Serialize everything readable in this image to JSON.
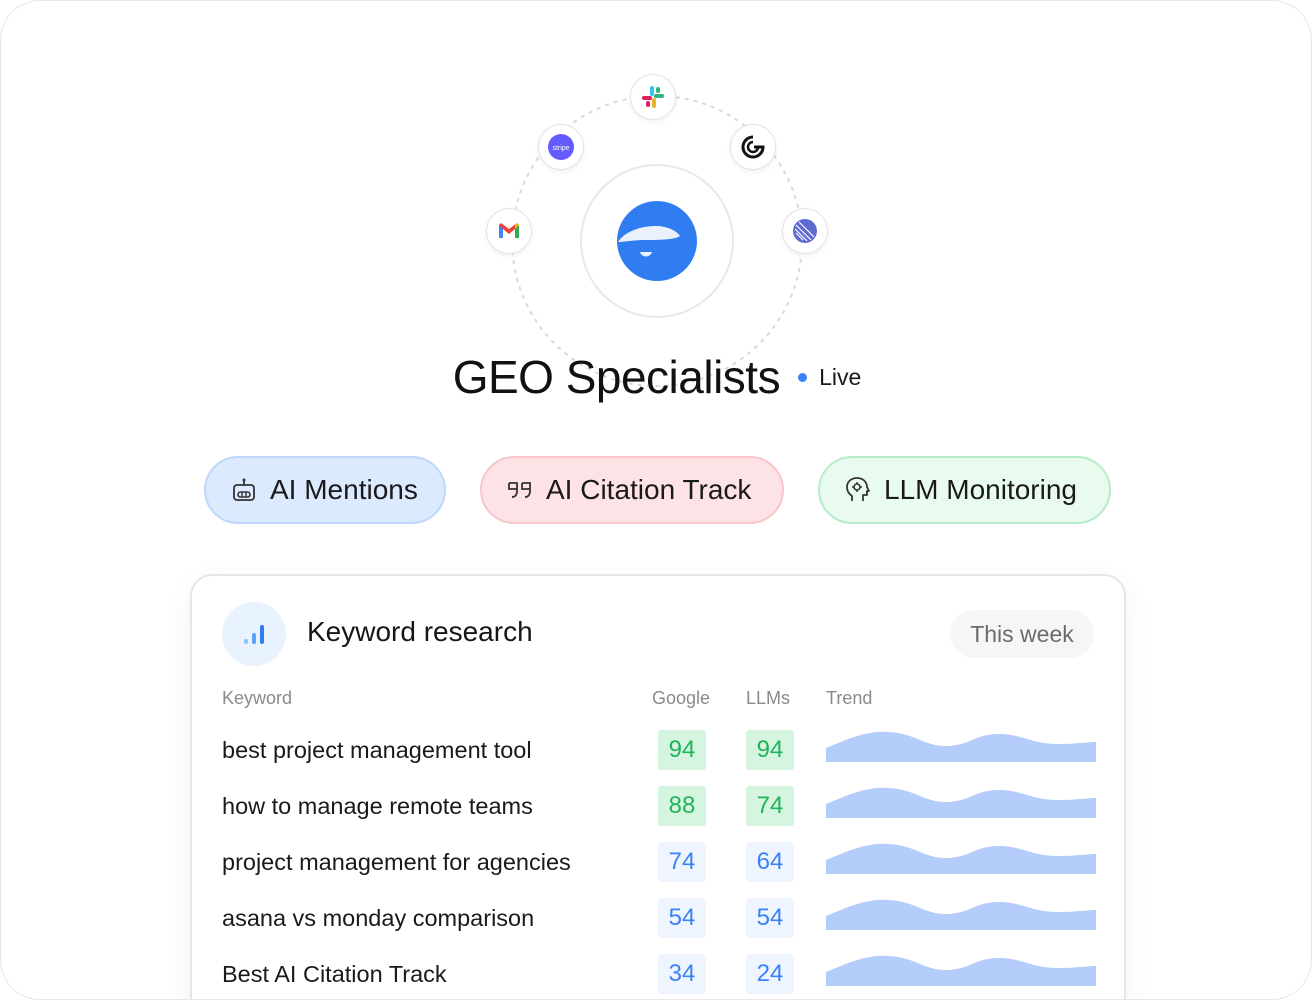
{
  "orbit": {
    "integrations": [
      {
        "name": "slack-icon"
      },
      {
        "name": "stripe-icon",
        "label": "stripe"
      },
      {
        "name": "grok-icon"
      },
      {
        "name": "gmail-icon"
      },
      {
        "name": "linear-icon"
      }
    ],
    "hub_icon": "brand-logo-icon"
  },
  "header": {
    "title": "GEO Specialists",
    "status": "Live",
    "status_color": "#3b82f6"
  },
  "pills": [
    {
      "label": "AI Mentions",
      "icon": "robot-icon",
      "color": "#dbeafe"
    },
    {
      "label": "AI Citation Track",
      "icon": "quote-icon",
      "color": "#fde3e5"
    },
    {
      "label": "LLM Monitoring",
      "icon": "brain-head-icon",
      "color": "#e9fbef"
    }
  ],
  "card": {
    "title": "Keyword research",
    "period": "This week",
    "icon": "bar-chart-icon",
    "columns": {
      "keyword": "Keyword",
      "google": "Google",
      "llms": "LLMs",
      "trend": "Trend"
    },
    "rows": [
      {
        "keyword": "best project management tool",
        "google": "94",
        "llms": "94"
      },
      {
        "keyword": "how to manage remote teams",
        "google": "88",
        "llms": "74"
      },
      {
        "keyword": "project management for agencies",
        "google": "74",
        "llms": "64"
      },
      {
        "keyword": "asana vs monday comparison",
        "google": "54",
        "llms": "54"
      },
      {
        "keyword": "Best AI Citation Track",
        "google": "34",
        "llms": "24"
      }
    ],
    "colors": {
      "high": "#21b35a",
      "normal": "#3b82f6",
      "trend": "#b4cdfa"
    }
  }
}
